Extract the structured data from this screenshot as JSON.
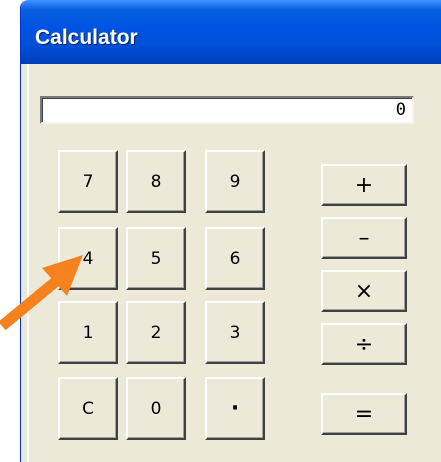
{
  "window": {
    "title": "Calculator"
  },
  "display": {
    "value": "0"
  },
  "keypad": {
    "rows": [
      [
        "7",
        "8",
        "9"
      ],
      [
        "4",
        "5",
        "6"
      ],
      [
        "1",
        "2",
        "3"
      ],
      [
        "C",
        "0",
        "·"
      ]
    ]
  },
  "operators": {
    "add": "+",
    "subtract": "–",
    "multiply": "×",
    "divide": "÷",
    "equals": "="
  },
  "colors": {
    "titlebar": "#0054e3",
    "face": "#ece9d8",
    "annotation_arrow": "#f5811f"
  }
}
